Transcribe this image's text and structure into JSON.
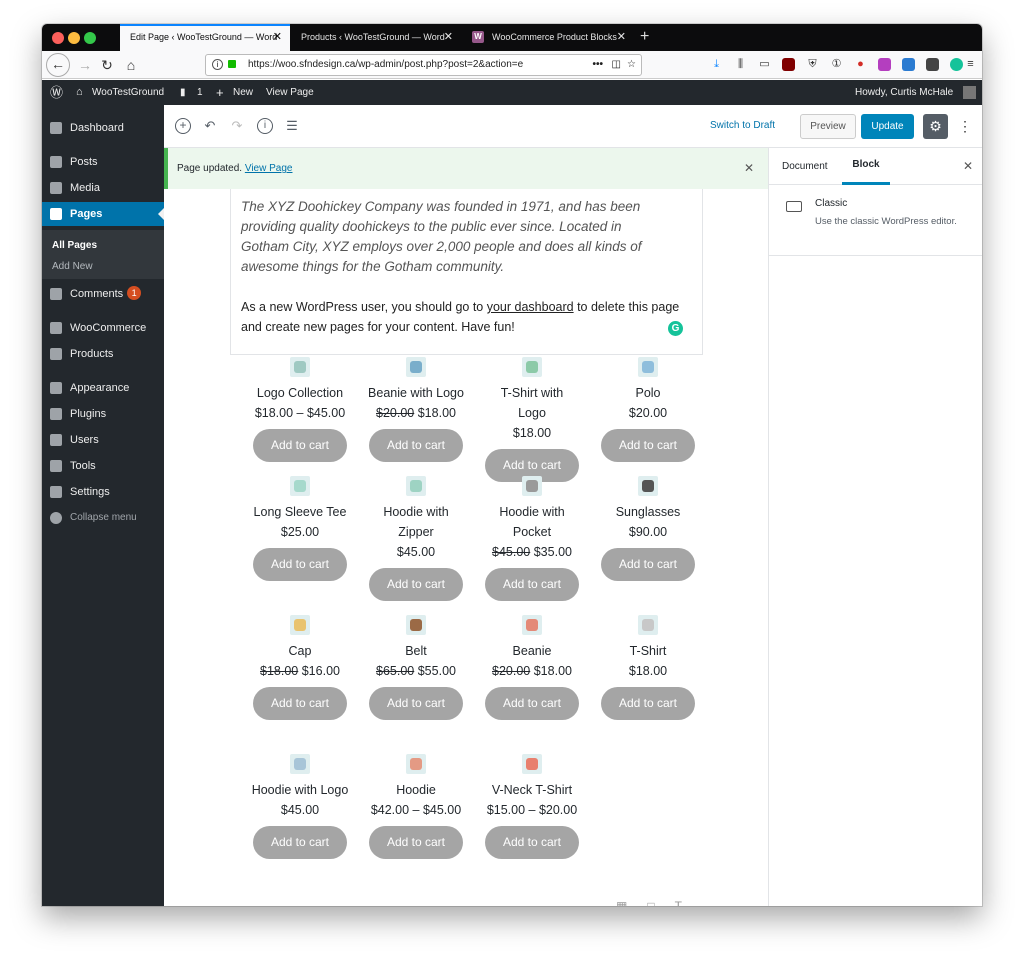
{
  "browser": {
    "tabs": [
      {
        "label": "Edit Page ‹ WooTestGround — Word"
      },
      {
        "label": "Products ‹ WooTestGround — Word"
      },
      {
        "label": "WooCommerce Product Blocks"
      }
    ],
    "url": "https://woo.sfndesign.ca/wp-admin/post.php?post=2&action=e"
  },
  "adminbar": {
    "site": "WooTestGround",
    "comments_count": "1",
    "new_label": "New",
    "view_page": "View Page",
    "howdy": "Howdy, Curtis McHale"
  },
  "menu": {
    "dashboard": "Dashboard",
    "posts": "Posts",
    "media": "Media",
    "pages": "Pages",
    "all_pages": "All Pages",
    "add_new": "Add New",
    "comments": "Comments",
    "comments_badge": "1",
    "woocommerce": "WooCommerce",
    "products": "Products",
    "appearance": "Appearance",
    "plugins": "Plugins",
    "users": "Users",
    "tools": "Tools",
    "settings": "Settings",
    "collapse": "Collapse menu"
  },
  "toolbar": {
    "switch_draft": "Switch to Draft",
    "preview": "Preview",
    "update": "Update"
  },
  "notice": {
    "text": "Page updated.",
    "link": "View Page"
  },
  "classic": {
    "italic_line0": "The XYZ Doohickey Company was founded in 1971, and has been",
    "italic_line1": "providing quality doohickeys to the public ever since. Located in",
    "italic_line2": "Gotham City, XYZ employs over 2,000 people and does all kinds of",
    "italic_line3": "awesome things for the Gotham community.",
    "para_a": "As a new WordPress user, you should go to ",
    "para_link": "your dashboard",
    "para_b": " to delete this page and create new pages for your content. Have fun!"
  },
  "add_to_cart": "Add to cart",
  "products": [
    {
      "name": "Logo Collection",
      "price": "$18.00 – $45.00",
      "color": "#9fc9c2"
    },
    {
      "name": "Beanie with Logo",
      "old": "$20.00",
      "price": "$18.00",
      "color": "#7aaecb"
    },
    {
      "name": "T-Shirt with Logo",
      "price": "$18.00",
      "color": "#8ccaa8"
    },
    {
      "name": "Polo",
      "price": "$20.00",
      "color": "#8fbedc"
    },
    {
      "name": "Long Sleeve Tee",
      "price": "$25.00",
      "color": "#a6d9cc"
    },
    {
      "name": "Hoodie with Zipper",
      "price": "$45.00",
      "color": "#9ed3c3"
    },
    {
      "name": "Hoodie with Pocket",
      "old": "$45.00",
      "price": "$35.00",
      "color": "#9a9a9a"
    },
    {
      "name": "Sunglasses",
      "price": "$90.00",
      "color": "#555555"
    },
    {
      "name": "Cap",
      "old": "$18.00",
      "price": "$16.00",
      "color": "#e9c36e"
    },
    {
      "name": "Belt",
      "old": "$65.00",
      "price": "$55.00",
      "color": "#9b6a46"
    },
    {
      "name": "Beanie",
      "old": "$20.00",
      "price": "$18.00",
      "color": "#e48a78"
    },
    {
      "name": "T-Shirt",
      "price": "$18.00",
      "color": "#c8c8c8"
    },
    {
      "name": "Hoodie with Logo",
      "price": "$45.00",
      "color": "#a8c5d8"
    },
    {
      "name": "Hoodie",
      "price": "$42.00 – $45.00",
      "color": "#e49a84"
    },
    {
      "name": "V-Neck T-Shirt",
      "price": "$15.00 – $20.00",
      "color": "#e8806e"
    }
  ],
  "sidebar": {
    "tab_document": "Document",
    "tab_block": "Block",
    "block_name": "Classic",
    "block_desc": "Use the classic WordPress editor."
  },
  "colors": {
    "accent": "#0085ba",
    "admin_dark": "#23282d",
    "current_menu": "#0073aa",
    "button_gray": "#a5a5a5"
  }
}
